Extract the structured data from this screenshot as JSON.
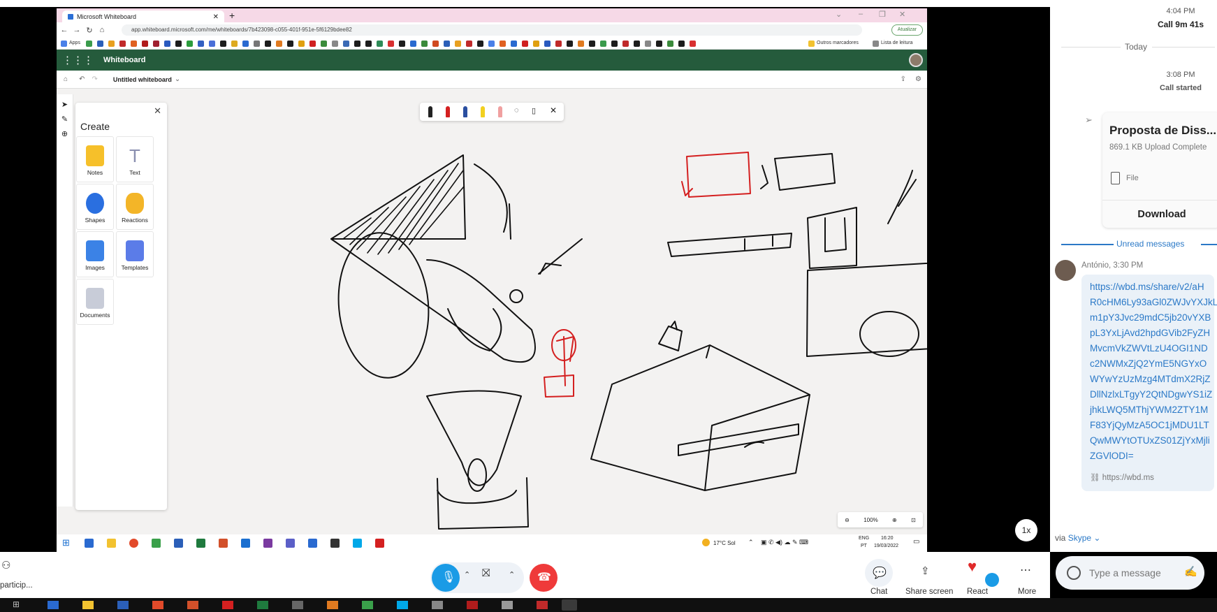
{
  "browser": {
    "tab_title": "Microsoft Whiteboard",
    "url": "app.whiteboard.microsoft.com/me/whiteboards/7b423098-c055-401f-951e-5f6129bdee82",
    "update_button": "Atualizar",
    "bookmarks_apps": "Apps",
    "bookmarks_other": "Outros marcadores",
    "bookmarks_reading": "Lista de leitura"
  },
  "whiteboard": {
    "app_title": "Whiteboard",
    "board_name": "Untitled whiteboard",
    "create_panel_title": "Create",
    "create_items": [
      "Notes",
      "Text",
      "Shapes",
      "Reactions",
      "Images",
      "Templates",
      "Documents"
    ],
    "zoom_level": "100%"
  },
  "windows_taskbar": {
    "weather": "17°C Sol",
    "lang_top": "ENG",
    "lang_bottom": "PT",
    "time": "16:20",
    "date": "19/03/2022"
  },
  "playback_speed": "1x",
  "chat": {
    "entry1_time": "4:04 PM",
    "entry1_text": "Call 9m 41s",
    "day_separator": "Today",
    "entry2_time": "3:08 PM",
    "entry2_text": "Call started",
    "file_card": {
      "title": "Proposta de Diss...",
      "subtitle": "869.1 KB Upload Complete",
      "file_label": "File",
      "download_label": "Download"
    },
    "unread_label": "Unread messages",
    "message": {
      "author_time": "António, 3:30 PM",
      "link_lines": [
        "https://wbd.ms/share/v2/aH",
        "R0cHM6Ly93aGl0ZWJvYXJkL",
        "m1pY3Jvc29mdC5jb20vYXB",
        "pL3YxLjAvd2hpdGVib2FyZH",
        "MvcmVkZWVtLzU4OGI1ND",
        "c2NWMxZjQ2YmE5NGYxO",
        "WYwYzUzMzg4MTdmX2RjZ",
        "DllNzlxLTgyY2QtNDgwYS1iZ",
        "jhkLWQ5MThjYWM2ZTY1M",
        "F83YjQyMzA5OC1jMDU1LT",
        "QwMWYtOTUxZS01ZjYxMjli",
        "ZGVlODI="
      ],
      "link_preview": "https://wbd.ms"
    },
    "via_prefix": "via",
    "via_app": "Skype",
    "input_placeholder": "Type a message"
  },
  "call_controls": {
    "participants_label": "particip...",
    "chat_label": "Chat",
    "share_label": "Share screen",
    "react_label": "React",
    "more_label": "More"
  },
  "colors": {
    "whiteboard_green": "#255b3c",
    "skype_blue": "#1a9be6",
    "end_call_red": "#ef3a3a",
    "link_blue": "#2b79c7"
  }
}
